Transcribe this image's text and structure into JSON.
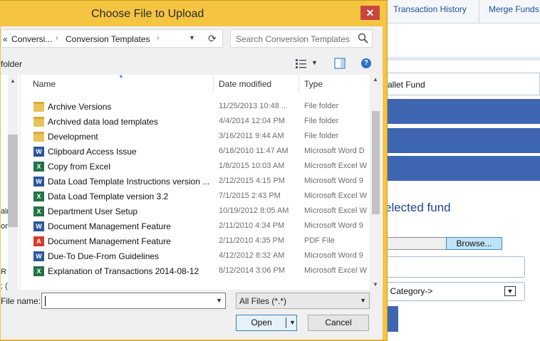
{
  "background": {
    "tabs": [
      "Transaction History",
      "Merge Funds"
    ],
    "fund_field": "allet Fund",
    "selected_fund_text": "elected fund",
    "browse_label": "Browse...",
    "category_select": "t Category->"
  },
  "dialog": {
    "title": "Choose File to Upload",
    "close_symbol": "✕",
    "breadcrumb": {
      "overflow": "«",
      "items": [
        "Conversi...",
        "Conversion Templates"
      ]
    },
    "search_placeholder": "Search Conversion Templates",
    "new_folder_label": "folder",
    "columns": {
      "name": "Name",
      "date": "Date modified",
      "type": "Type"
    },
    "files": [
      {
        "name": "Archive Versions",
        "date": "11/25/2013 10:48 ...",
        "type": "File folder",
        "icon": "folder-icon"
      },
      {
        "name": "Archived data load templates",
        "date": "4/4/2014 12:04 PM",
        "type": "File folder",
        "icon": "folder-icon"
      },
      {
        "name": "Development",
        "date": "3/16/2011 9:44 AM",
        "type": "File folder",
        "icon": "folder-icon"
      },
      {
        "name": "Clipboard Access Issue",
        "date": "6/18/2010 11:47 AM",
        "type": "Microsoft Word D",
        "icon": "word-icon"
      },
      {
        "name": "Copy from Excel",
        "date": "1/8/2015 10:03 AM",
        "type": "Microsoft Excel W",
        "icon": "excel-icon"
      },
      {
        "name": "Data Load Template Instructions version ...",
        "date": "2/12/2015 4:15 PM",
        "type": "Microsoft Word 9",
        "icon": "word-icon"
      },
      {
        "name": "Data Load Template version 3.2",
        "date": "7/1/2015 2:43 PM",
        "type": "Microsoft Excel W",
        "icon": "excel-icon"
      },
      {
        "name": "Department User Setup",
        "date": "10/19/2012 8:05 AM",
        "type": "Microsoft Excel W",
        "icon": "excel-icon"
      },
      {
        "name": "Document Management Feature",
        "date": "2/11/2010 4:34 PM",
        "type": "Microsoft Word 9",
        "icon": "word-icon"
      },
      {
        "name": "Document Management Feature",
        "date": "2/11/2010 4:35 PM",
        "type": "PDF File",
        "icon": "pdf-icon"
      },
      {
        "name": "Due-To Due-From Guidelines",
        "date": "4/12/2012 8:32 AM",
        "type": "Microsoft Word 9",
        "icon": "word-icon"
      },
      {
        "name": "Explanation of Transactions 2014-08-12",
        "date": "8/12/2014 3:06 PM",
        "type": "Microsoft Excel W",
        "icon": "excel-icon"
      }
    ],
    "nav_fragments": [
      "air",
      "on",
      "R",
      "; ("
    ],
    "file_name_label": "File name:",
    "file_name_value": "",
    "filter_value": "All Files (*.*)",
    "open_label": "Open",
    "cancel_label": "Cancel"
  }
}
